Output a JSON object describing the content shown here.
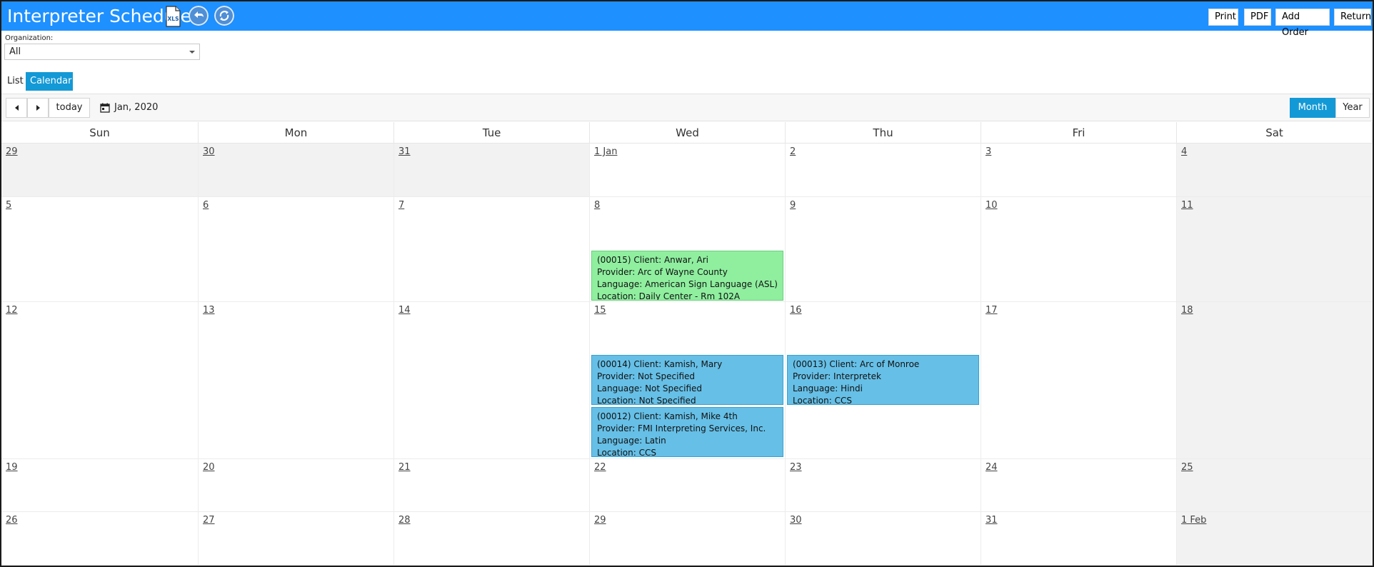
{
  "header": {
    "title": "Interpreter Schedule",
    "xls_icon_text": "XLS",
    "buttons": {
      "print": "Print",
      "pdf": "PDF",
      "add_order": "Add Order",
      "return": "Return"
    },
    "colors": {
      "bar": "#1e90ff"
    }
  },
  "filter": {
    "label": "Organization:",
    "value": "All"
  },
  "views": {
    "list": "List",
    "calendar": "Calendar",
    "active": "Calendar"
  },
  "toolbar": {
    "today": "today",
    "period": "Jan, 2020",
    "month": "Month",
    "year": "Year",
    "active_mode": "Month"
  },
  "weekdays": [
    "Sun",
    "Mon",
    "Tue",
    "Wed",
    "Thu",
    "Fri",
    "Sat"
  ],
  "weeks": [
    [
      "29",
      "30",
      "31",
      "1 Jan",
      "2",
      "3",
      "4"
    ],
    [
      "5",
      "6",
      "7",
      "8",
      "9",
      "10",
      "11"
    ],
    [
      "12",
      "13",
      "14",
      "15",
      "16",
      "17",
      "18"
    ],
    [
      "19",
      "20",
      "21",
      "22",
      "23",
      "24",
      "25"
    ],
    [
      "26",
      "27",
      "28",
      "29",
      "30",
      "31",
      "1 Feb"
    ]
  ],
  "events": {
    "e00015": [
      "(00015) Client: Anwar, Ari",
      "Provider: Arc of Wayne County",
      "Language: American Sign Language (ASL)",
      "Location: Daily Center - Rm 102A"
    ],
    "e00014": [
      "(00014) Client: Kamish, Mary",
      "Provider: Not Specified",
      "Language: Not Specified",
      "Location: Not Specified"
    ],
    "e00013": [
      "(00013) Client: Arc of Monroe",
      "Provider: Interpretek",
      "Language: Hindi",
      "Location: CCS"
    ],
    "e00012": [
      "(00012) Client: Kamish, Mike 4th",
      "Provider: FMI Interpreting Services, Inc.",
      "Language: Latin",
      "Location: CCS"
    ]
  }
}
